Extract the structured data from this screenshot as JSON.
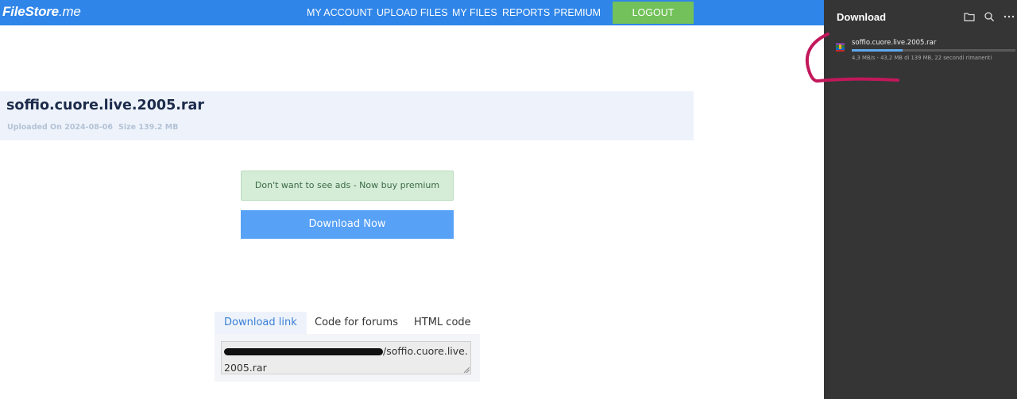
{
  "site": {
    "logo_main": "FileStore",
    "logo_suffix": ".me",
    "nav": [
      "MY ACCOUNT",
      "UPLOAD FILES",
      "MY FILES",
      "REPORTS",
      "PREMIUM"
    ],
    "logout": "LOGOUT"
  },
  "file": {
    "name": "soffio.cuore.live.2005.rar",
    "uploaded": "Uploaded On 2024-08-06",
    "size": "Size 139.2 MB"
  },
  "premium_banner": "Don't want to see ads - Now buy premium",
  "download_button": "Download Now",
  "link_tabs": [
    "Download link",
    "Code for forums",
    "HTML code"
  ],
  "link_text_partial": "/soffio.cuore.live.2005.rar",
  "download_panel": {
    "title": "Download",
    "icons": [
      "folder-icon",
      "search-icon",
      "more-icon"
    ],
    "item": {
      "name": "soffio.cuore.live.2005.rar",
      "status": "4,3 MB/s - 43,2 MB di 139 MB, 22 secondi rimanenti",
      "progress_percent": 31
    }
  },
  "colors": {
    "topbar": "#2f85e8",
    "logout": "#72c15a",
    "download_button": "#57a1f7",
    "panel": "#353535",
    "annotation": "#c2185b"
  }
}
